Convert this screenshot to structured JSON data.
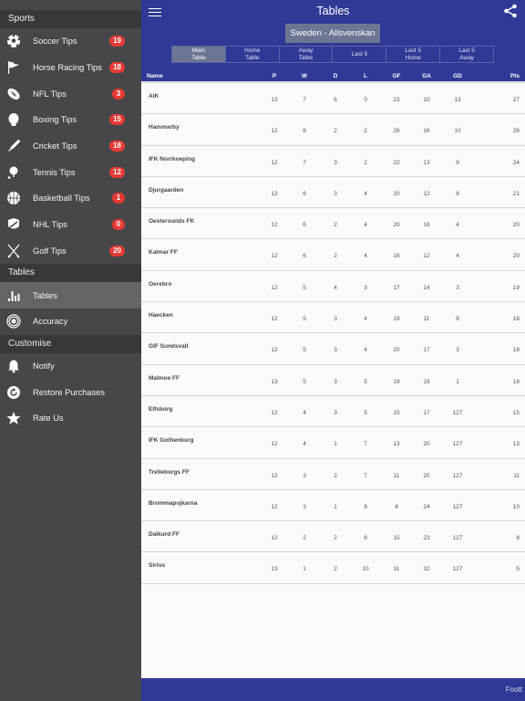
{
  "sidebar": {
    "sections": {
      "sports": "Sports",
      "tables": "Tables",
      "customise": "Customise"
    },
    "sports_items": [
      {
        "label": "Soccer Tips",
        "icon": "soccer-ball-icon",
        "badge": "19"
      },
      {
        "label": "Horse Racing Tips",
        "icon": "flag-icon",
        "badge": "18"
      },
      {
        "label": "NFL Tips",
        "icon": "football-icon",
        "badge": "3"
      },
      {
        "label": "Boxing Tips",
        "icon": "boxing-glove-icon",
        "badge": "15"
      },
      {
        "label": "Cricket Tips",
        "icon": "cricket-bat-icon",
        "badge": "18"
      },
      {
        "label": "Tennis Tips",
        "icon": "tennis-icon",
        "badge": "12"
      },
      {
        "label": "Basketball Tips",
        "icon": "basketball-icon",
        "badge": "1"
      },
      {
        "label": "NHL Tips",
        "icon": "hockey-icon",
        "badge": "0"
      },
      {
        "label": "Golf Tips",
        "icon": "golf-clubs-icon",
        "badge": "20"
      }
    ],
    "tables_items": [
      {
        "label": "Tables",
        "icon": "bar-chart-icon"
      },
      {
        "label": "Accuracy",
        "icon": "target-icon"
      }
    ],
    "customise_items": [
      {
        "label": "Notify",
        "icon": "bell-icon"
      },
      {
        "label": "Restore Purchases",
        "icon": "restore-icon"
      },
      {
        "label": "Rate Us",
        "icon": "star-icon"
      }
    ]
  },
  "header": {
    "title": "Tables",
    "league": "Sweden - Allsvenskan",
    "tabs": [
      "Main\nTable",
      "Home\nTable",
      "Away\nTable",
      "Last 5",
      "Last 5\nHome",
      "Last 5\nAway"
    ],
    "active_tab": 0
  },
  "table": {
    "columns": [
      "Name",
      "P",
      "W",
      "D",
      "L",
      "GF",
      "GA",
      "GD",
      "Pts"
    ],
    "rows": [
      [
        "AIK",
        "13",
        "7",
        "6",
        "0",
        "23",
        "10",
        "13",
        "27"
      ],
      [
        "Hammarby",
        "12",
        "8",
        "2",
        "2",
        "26",
        "16",
        "10",
        "26"
      ],
      [
        "IFK Norrkoeping",
        "12",
        "7",
        "3",
        "2",
        "22",
        "13",
        "9",
        "24"
      ],
      [
        "Djurgaarden",
        "13",
        "6",
        "3",
        "4",
        "20",
        "12",
        "8",
        "21"
      ],
      [
        "Oestersunds FK",
        "12",
        "6",
        "2",
        "4",
        "20",
        "16",
        "4",
        "20"
      ],
      [
        "Kalmar FF",
        "12",
        "6",
        "2",
        "4",
        "16",
        "12",
        "4",
        "20"
      ],
      [
        "Oerebro",
        "12",
        "5",
        "4",
        "3",
        "17",
        "14",
        "3",
        "19"
      ],
      [
        "Haecken",
        "12",
        "5",
        "3",
        "4",
        "19",
        "11",
        "8",
        "18"
      ],
      [
        "GIF Sundsvall",
        "12",
        "5",
        "3",
        "4",
        "20",
        "17",
        "3",
        "18"
      ],
      [
        "Malmoe FF",
        "13",
        "5",
        "3",
        "5",
        "19",
        "18",
        "1",
        "18"
      ],
      [
        "Elfsborg",
        "12",
        "4",
        "3",
        "5",
        "15",
        "17",
        "127",
        "15"
      ],
      [
        "IFK Gothenburg",
        "12",
        "4",
        "1",
        "7",
        "13",
        "20",
        "127",
        "13"
      ],
      [
        "Trelleborgs FF",
        "12",
        "3",
        "2",
        "7",
        "11",
        "20",
        "127",
        "11"
      ],
      [
        "Brommapojkarna",
        "12",
        "3",
        "1",
        "8",
        "8",
        "24",
        "127",
        "10"
      ],
      [
        "Dalkurd FF",
        "12",
        "2",
        "2",
        "8",
        "15",
        "23",
        "127",
        "8"
      ],
      [
        "Sirius",
        "13",
        "1",
        "2",
        "10",
        "11",
        "32",
        "127",
        "5"
      ]
    ]
  },
  "footer": {
    "text": "Foott"
  },
  "colors": {
    "brand": "#2f3a96",
    "badge": "#e53a35",
    "sidebar_bg": "#474749",
    "active_tab": "#6c7692"
  }
}
